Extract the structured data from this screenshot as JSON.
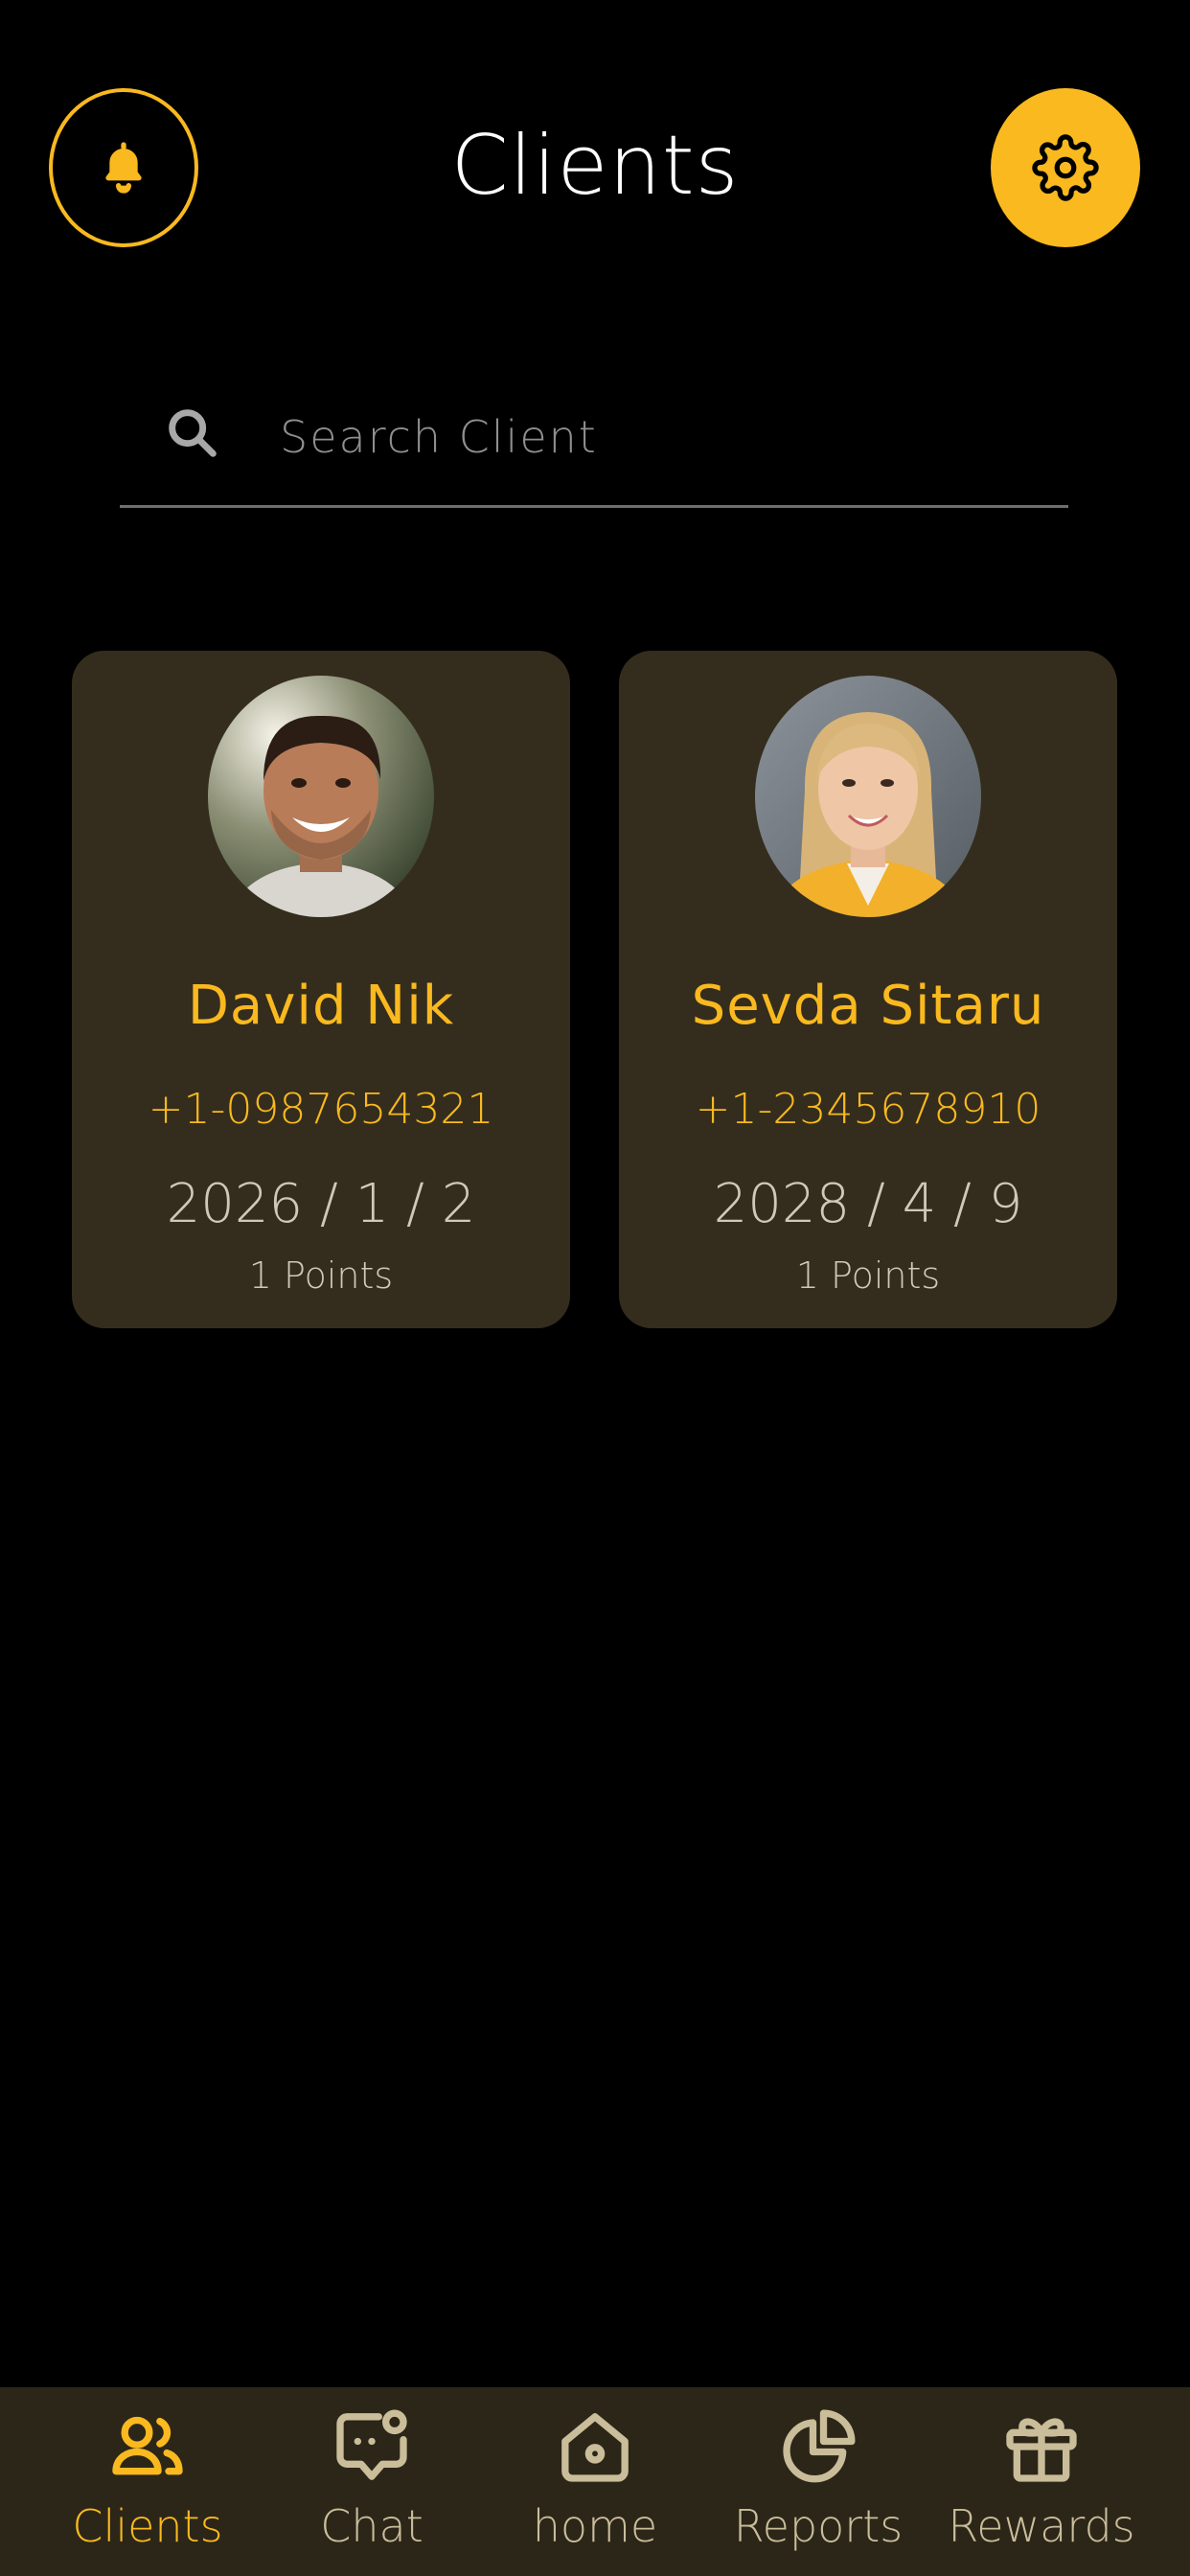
{
  "header": {
    "title": "Clients",
    "bell_icon": "bell-icon",
    "settings_icon": "gear-icon"
  },
  "search": {
    "placeholder": "Search Client",
    "value": "",
    "icon": "search-icon"
  },
  "clients": [
    {
      "name": "David Nik",
      "phone": "+1-0987654321",
      "date": "2026 / 1 / 2",
      "points": "1 Points",
      "avatar": "avatar-man-smiling"
    },
    {
      "name": "Sevda Sitaru",
      "phone": "+1-2345678910",
      "date": "2028 / 4 / 9",
      "points": "1 Points",
      "avatar": "avatar-woman-yellow-blazer"
    }
  ],
  "nav": {
    "items": [
      {
        "label": "Clients",
        "icon": "users-icon",
        "active": true
      },
      {
        "label": "Chat",
        "icon": "chat-icon",
        "active": false
      },
      {
        "label": "home",
        "icon": "home-icon",
        "active": false
      },
      {
        "label": "Reports",
        "icon": "pie-chart-icon",
        "active": false
      },
      {
        "label": "Rewards",
        "icon": "gift-icon",
        "active": false
      }
    ]
  },
  "colors": {
    "accent": "#F9B91F",
    "background": "#000000",
    "card": "#342D1D",
    "nav_background": "#2C2619",
    "inactive_nav": "#C9BD9A"
  }
}
